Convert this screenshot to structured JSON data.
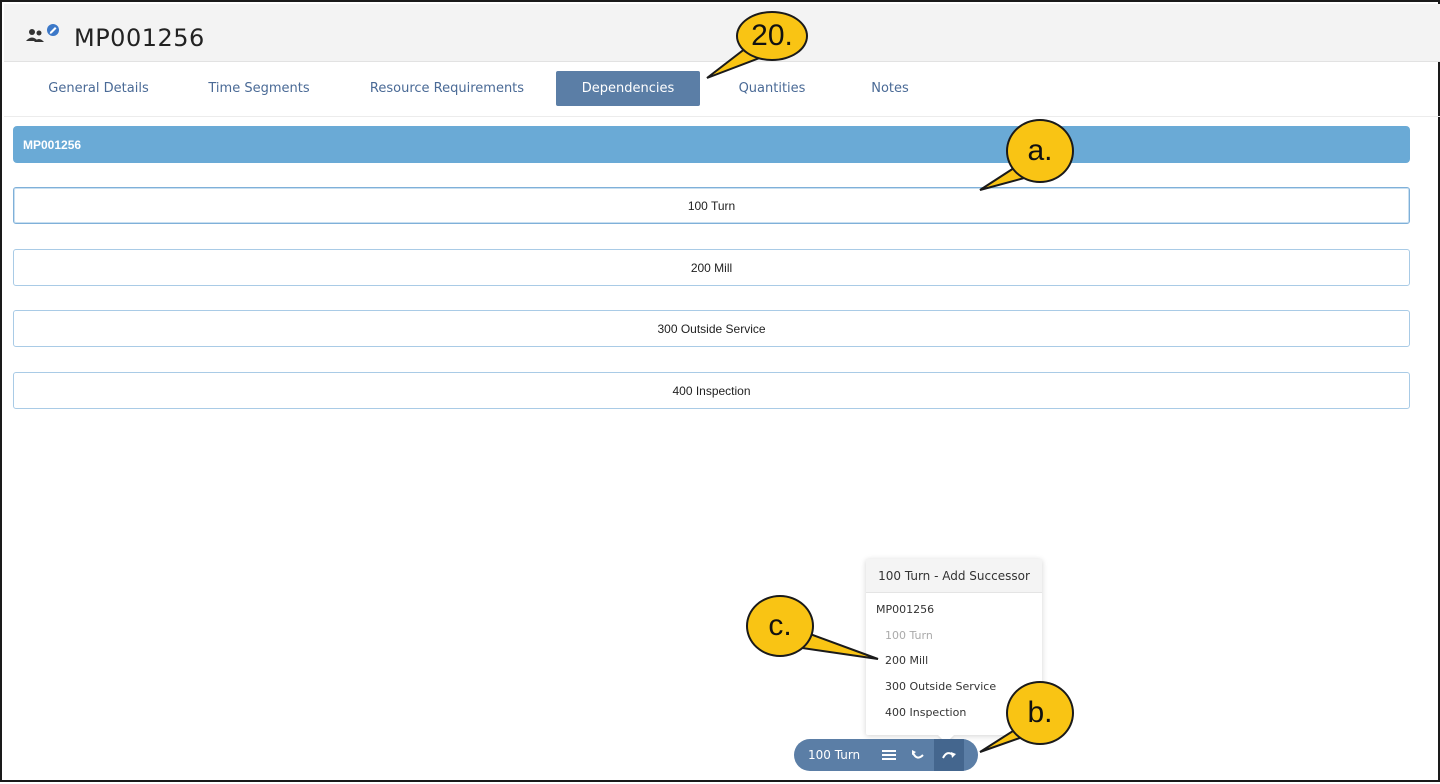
{
  "window": {
    "title": "MP001256",
    "icon": "people-edit-icon"
  },
  "tabs": [
    {
      "label": "General Details"
    },
    {
      "label": "Time Segments"
    },
    {
      "label": "Resource Requirements"
    },
    {
      "label": "Dependencies",
      "active": true
    },
    {
      "label": "Quantities"
    },
    {
      "label": "Notes"
    }
  ],
  "group": {
    "label": "MP001256"
  },
  "operations": [
    {
      "label": "100 Turn"
    },
    {
      "label": "200 Mill"
    },
    {
      "label": "300 Outside Service"
    },
    {
      "label": "400 Inspection"
    }
  ],
  "popup": {
    "title": "100 Turn - Add Successor",
    "group": "MP001256",
    "items": [
      {
        "label": "100 Turn",
        "disabled": true
      },
      {
        "label": "200 Mill"
      },
      {
        "label": "300 Outside Service"
      },
      {
        "label": "400 Inspection"
      }
    ]
  },
  "toolbar": {
    "label": "100 Turn",
    "buttons": [
      "list-icon",
      "predecessor-icon",
      "successor-icon"
    ]
  },
  "callouts": {
    "step": "20.",
    "a": "a.",
    "b": "b.",
    "c": "c."
  },
  "colors": {
    "accent": "#5b7ea6",
    "header": "#6aaad6",
    "callout": "#f9c414"
  }
}
